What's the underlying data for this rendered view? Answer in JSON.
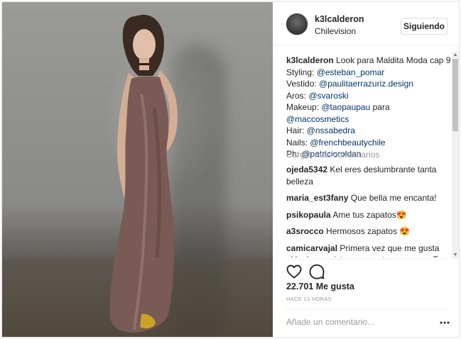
{
  "post": {
    "image_alt": "Mujer con vestido largo de satén",
    "header": {
      "username": "k3lcalderon",
      "location": "Chilevision",
      "follow_label": "Siguiendo"
    },
    "caption": [
      {
        "user": "k3lcalderon",
        "text": "Look para Maldita Moda cap 9"
      },
      {
        "label": "Styling: ",
        "mention": "@esteban_pomar"
      },
      {
        "label": "Vestido: ",
        "mention": "@paulitaerrazuriz.design"
      },
      {
        "label": "Aros: ",
        "mention": "@svaroski"
      },
      {
        "label": "Makeup: ",
        "mention": "@taopaupau",
        "suffix": " para"
      },
      {
        "label": "",
        "mention": "@maccosmetics"
      },
      {
        "label": "Hair: ",
        "mention": "@nssabedra"
      },
      {
        "label": "Nails: ",
        "mention": "@frenchbeautychile"
      },
      {
        "label": "Ph: ",
        "mention": "@patricioroldan"
      }
    ],
    "load_more_label": "Cargar más comentarios",
    "comments": [
      {
        "user": "ojeda5342",
        "text": "Kel eres deslumbrante tanta belleza"
      },
      {
        "user": "maria_est3fany",
        "text": "Que bella me encanta!"
      },
      {
        "user": "psikopaula",
        "text": "Ame tus zapatos😍"
      },
      {
        "user": "a3srocco",
        "text": "Hermosos zapatos 😍"
      },
      {
        "user": "camicarvajal",
        "text": "Primera vez que me gusta el look que vistes para este programa. Te veías bella bella. Salufos"
      }
    ],
    "likes_text": "22.701 Me gusta",
    "time_text": "HACE 13 HORAS",
    "add_comment_placeholder": "Añade un comentario...",
    "icons": {
      "like": "heart-icon",
      "comment": "comment-icon",
      "more": "more-options-icon"
    },
    "colors": {
      "link": "#003569",
      "border": "#efefef",
      "muted": "#999999",
      "dress": "#7a5a55"
    }
  }
}
